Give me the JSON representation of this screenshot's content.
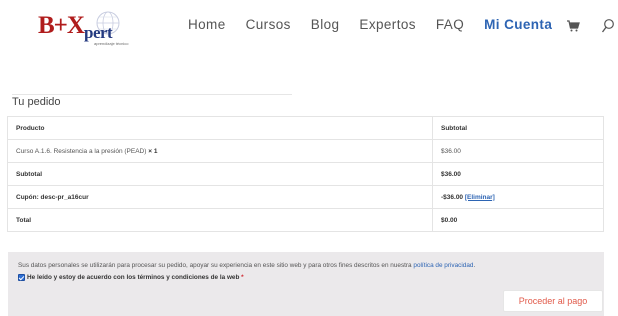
{
  "logo": {
    "main": "B+X",
    "pert": "pert",
    "tagline": "aprendizaje técnico",
    "colors": {
      "red": "#b01c1c",
      "blue": "#243a80"
    }
  },
  "nav": {
    "items": [
      {
        "label": "Home",
        "active": false
      },
      {
        "label": "Cursos",
        "active": false
      },
      {
        "label": "Blog",
        "active": false
      },
      {
        "label": "Expertos",
        "active": false
      },
      {
        "label": "FAQ",
        "active": false
      },
      {
        "label": "Mi Cuenta",
        "active": true
      }
    ],
    "cart_icon": "cart-icon",
    "search_icon": "search-icon",
    "accent": "#2d64b3"
  },
  "order": {
    "heading": "Tu pedido",
    "headers": {
      "product": "Producto",
      "subtotal": "Subtotal"
    },
    "item": {
      "name": "Curso A.1.6. Resistencia a la presión (PEAD)",
      "qty": "× 1",
      "price": "$36.00"
    },
    "subtotal": {
      "label": "Subtotal",
      "value": "$36.00"
    },
    "coupon": {
      "label": "Cupón: desc-pr_a16cur",
      "value": "-$36.00",
      "remove": "[Eliminar]"
    },
    "total": {
      "label": "Total",
      "value": "$0.00"
    }
  },
  "payment": {
    "privacy_text": "Sus datos personales se utilizarán para procesar su pedido, apoyar su experiencia en este sitio web y para otros fines descritos en nuestra",
    "privacy_link": "política de privacidad",
    "privacy_end": ".",
    "terms_text": "He leído y estoy de acuerdo con los términos y condiciones de la web",
    "terms_required": "*",
    "terms_checked": true,
    "place_order": "Proceder al pago",
    "button_color": "#e15b4b",
    "box_color": "#ebe9eb"
  }
}
